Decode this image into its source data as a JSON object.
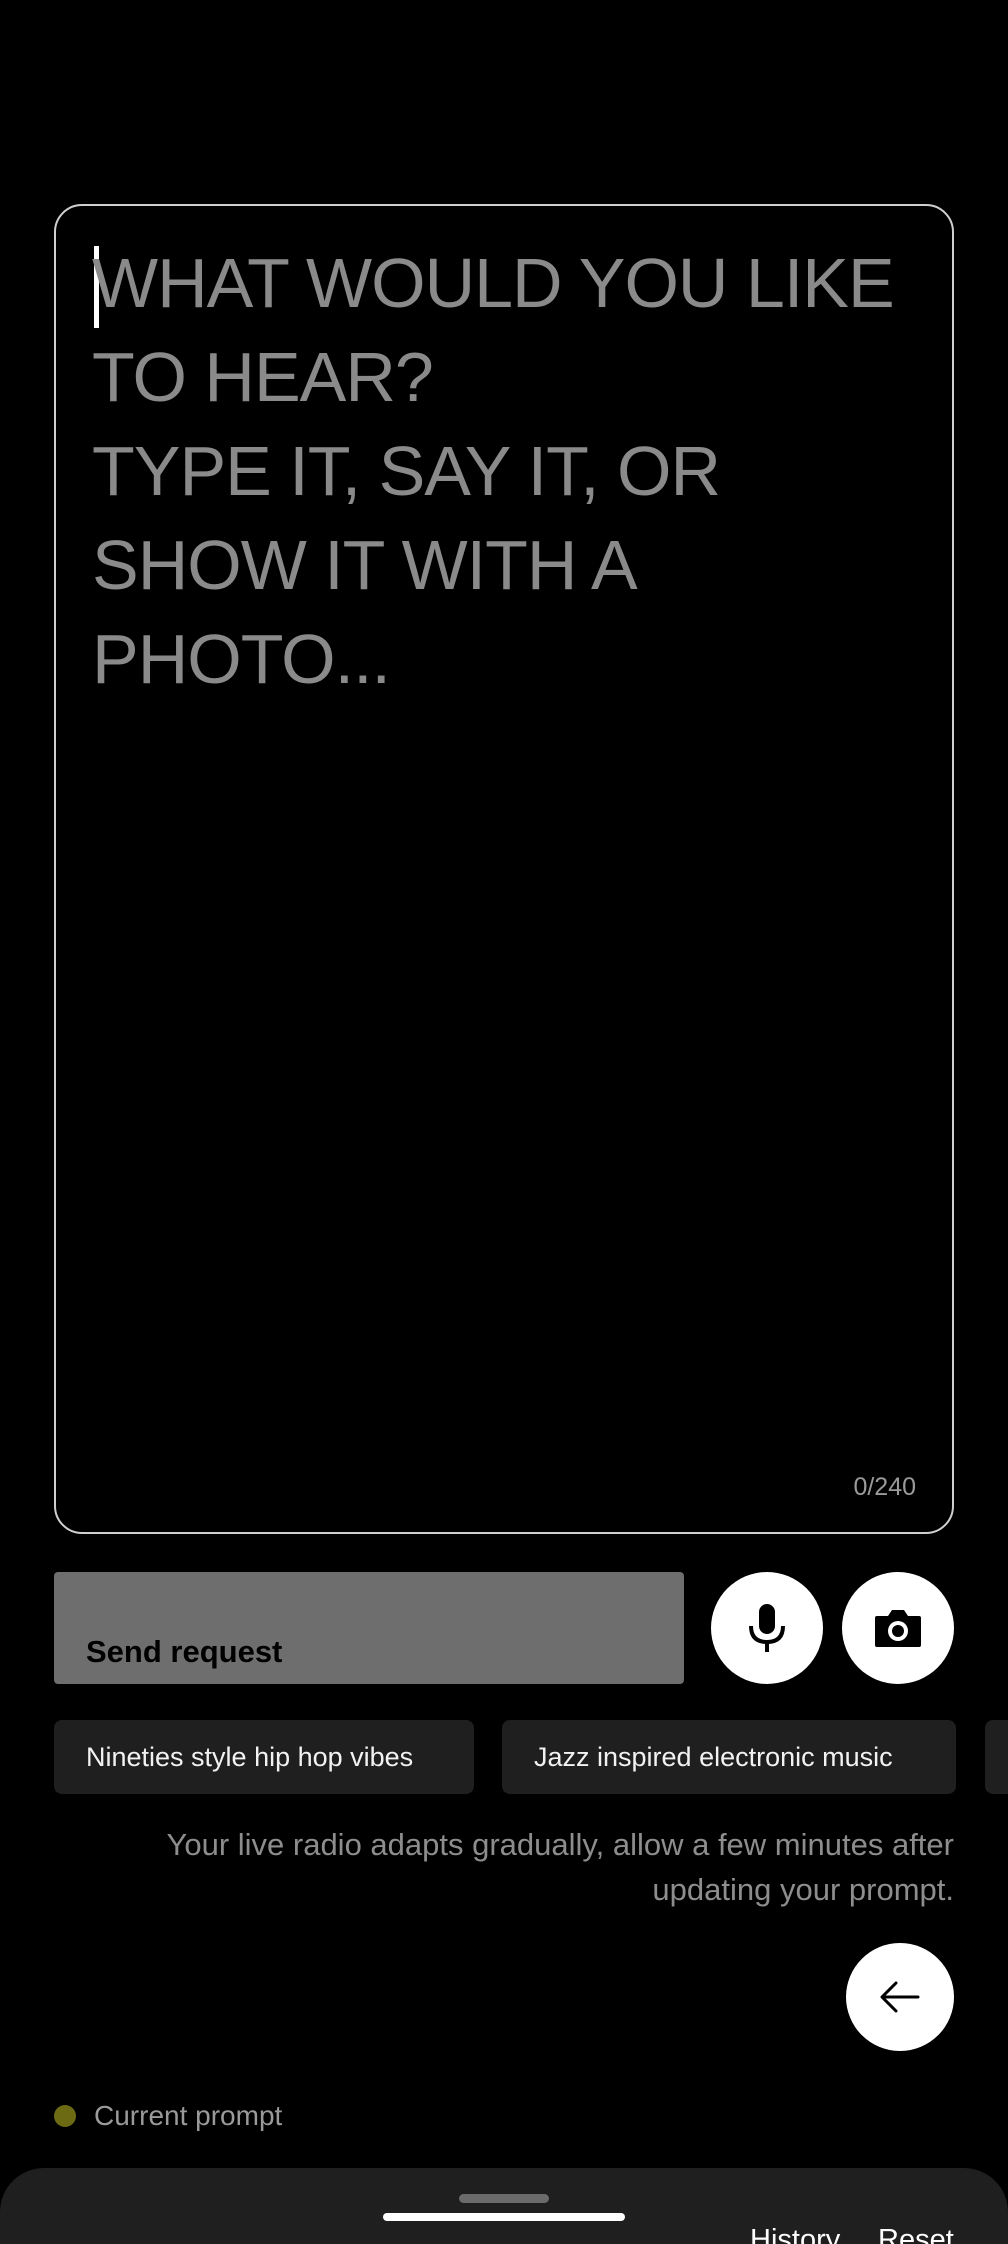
{
  "prompt": {
    "placeholder": "WHAT WOULD YOU LIKE TO HEAR?\nTYPE IT, SAY IT, OR SHOW IT WITH A PHOTO...",
    "value": "",
    "char_count": "0/240"
  },
  "actions": {
    "send_label": "Send request",
    "mic_icon": "microphone-icon",
    "camera_icon": "camera-icon"
  },
  "suggestions": [
    "Nineties style hip hop vibes",
    "Jazz inspired electronic music"
  ],
  "info_text": "Your live radio adapts gradually, allow a few minutes after updating your prompt.",
  "back_icon": "arrow-left-icon",
  "current_prompt": {
    "label": "Current prompt",
    "dot_color": "#6d6a14"
  },
  "bottom_sheet": {
    "history_label": "History",
    "reset_label": "Reset"
  },
  "colors": {
    "background": "#000000",
    "button_disabled": "#6e6e6e",
    "chip_background": "#1f1f1f",
    "placeholder_text": "#8a8a8a"
  }
}
